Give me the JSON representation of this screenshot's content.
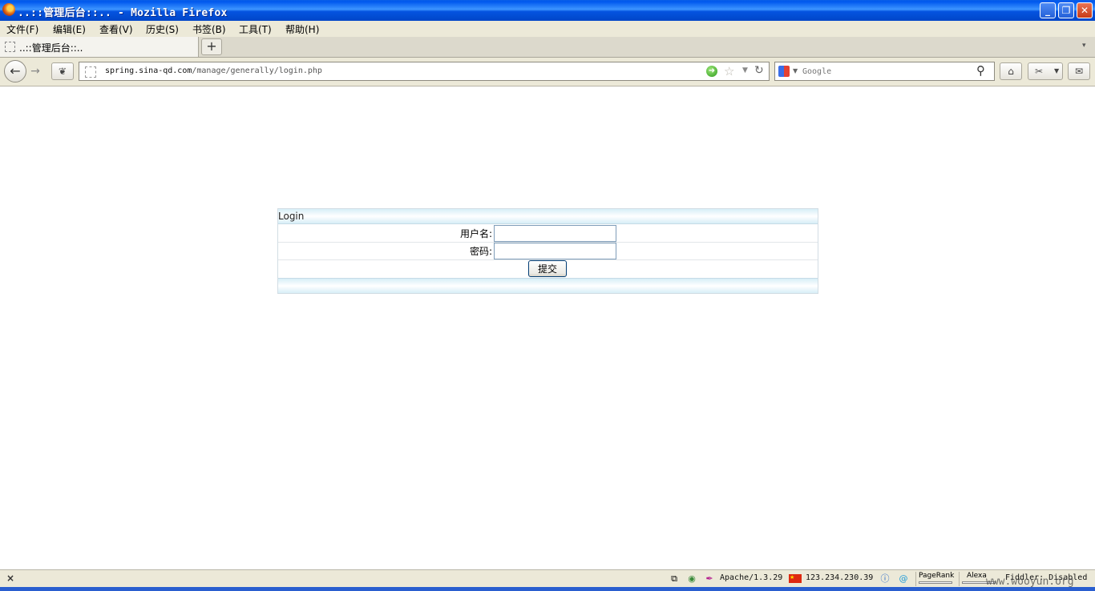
{
  "window": {
    "title": "..::管理后台::.. - Mozilla Firefox",
    "min_glyph": "_",
    "max_glyph": "❐",
    "close_glyph": "✕"
  },
  "menu": [
    "文件(F)",
    "编辑(E)",
    "查看(V)",
    "历史(S)",
    "书签(B)",
    "工具(T)",
    "帮助(H)"
  ],
  "tab": {
    "label": "..::管理后台::..",
    "new_tab_glyph": "+",
    "list_glyph": "▾"
  },
  "nav": {
    "url_host": "spring.sina-qd.com",
    "url_path": "/manage/generally/login.php",
    "search_placeholder": "Google",
    "back_glyph": "←",
    "forward_glyph": "→"
  },
  "login": {
    "header": "Login",
    "username_label": "用户名:",
    "username_value": "",
    "password_label": "密码:",
    "password_value": "",
    "submit_label": "提交"
  },
  "status": {
    "close_glyph": "×",
    "server": "Apache/1.3.29",
    "ip": "123.234.230.39",
    "pagerank_label": "PageRank",
    "alexa_label": "Alexa",
    "fiddler": "Fiddler: Disabled"
  },
  "watermark": "www.wooyun.org",
  "colors": {
    "titlebar": "#0058ee",
    "chrome": "#ece9d8",
    "login_header": "#d7eef7"
  }
}
